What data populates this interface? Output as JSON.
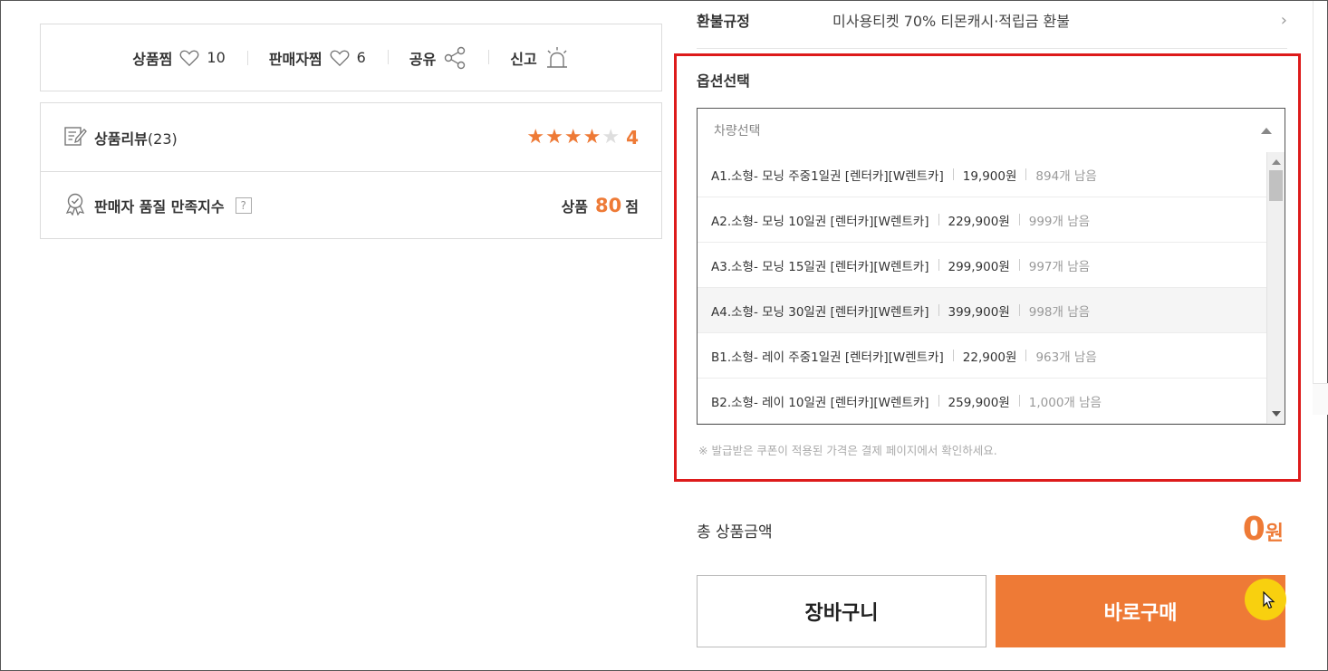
{
  "stats": {
    "wish_label": "상품찜",
    "wish_count": "10",
    "seller_label": "판매자찜",
    "seller_count": "6",
    "share_label": "공유",
    "report_label": "신고"
  },
  "review": {
    "label": "상품리뷰",
    "count": "(23)",
    "rating": "4",
    "stars_filled": 4,
    "stars_total": 5
  },
  "quality": {
    "label": "판매자 품질 만족지수",
    "help": "?",
    "prefix": "상품",
    "score": "80",
    "suffix": "점"
  },
  "refund": {
    "label": "환불규정",
    "text": "미사용티켓 70% 티몬캐시·적립금 환불",
    "chevron": "›"
  },
  "option": {
    "title": "옵션선택",
    "select_placeholder": "차량선택",
    "items": [
      {
        "name": "A1.소형- 모닝 주중1일권 [렌터카][W렌트카]",
        "price": "19,900원",
        "stock": "894개 남음"
      },
      {
        "name": "A2.소형- 모닝 10일권 [렌터카][W렌트카]",
        "price": "229,900원",
        "stock": "999개 남음"
      },
      {
        "name": "A3.소형- 모닝 15일권 [렌터카][W렌트카]",
        "price": "299,900원",
        "stock": "997개 남음"
      },
      {
        "name": "A4.소형- 모닝 30일권 [렌터카][W렌트카]",
        "price": "399,900원",
        "stock": "998개 남음"
      },
      {
        "name": "B1.소형- 레이 주중1일권 [렌터카][W렌트카]",
        "price": "22,900원",
        "stock": "963개 남음"
      },
      {
        "name": "B2.소형- 레이 10일권 [렌터카][W렌트카]",
        "price": "259,900원",
        "stock": "1,000개 남음"
      }
    ],
    "note": "※ 발급받은 쿠폰이 적용된 가격은 결제 페이지에서 확인하세요."
  },
  "total": {
    "label": "총 상품금액",
    "value": "0",
    "unit": "원"
  },
  "buttons": {
    "cart": "장바구니",
    "buy": "바로구매"
  },
  "colors": {
    "accent": "#ee7a36",
    "highlight_frame": "#dd1b1b",
    "cursor_highlight": "#f8d00f"
  }
}
